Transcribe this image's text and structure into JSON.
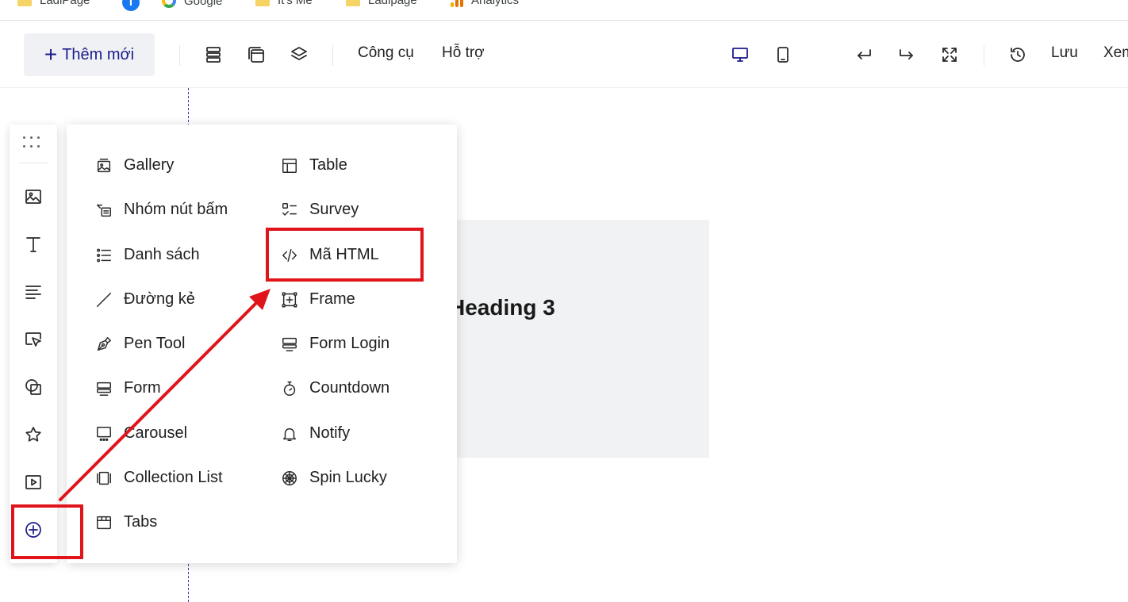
{
  "bookmarks": [
    "LadiPage",
    "",
    "Google",
    "It's Me",
    "Ladipage",
    "Analytics"
  ],
  "toolbar": {
    "add_label": "Thêm mới",
    "tools_label": "Công cụ",
    "support_label": "Hỗ trợ",
    "save_label": "Lưu",
    "preview_label": "Xem",
    "accent": "#1c1b8c"
  },
  "canvas": {
    "heading": "Heading 3"
  },
  "sidebar": {
    "icons": [
      "drag-handle-icon",
      "image-icon",
      "text-icon",
      "paragraph-icon",
      "button-icon",
      "shape-icon",
      "star-icon",
      "video-icon",
      "add-circle-icon"
    ]
  },
  "menu": {
    "left": [
      "Gallery",
      "Nhóm nút bấm",
      "Danh sách",
      "Đường kẻ",
      "Pen Tool",
      "Form",
      "Carousel",
      "Collection List",
      "Tabs"
    ],
    "right": [
      "Table",
      "Survey",
      "Mã HTML",
      "Frame",
      "Form Login",
      "Countdown",
      "Notify",
      "Spin Lucky"
    ]
  },
  "annotation": {
    "color": "#e0151b"
  }
}
